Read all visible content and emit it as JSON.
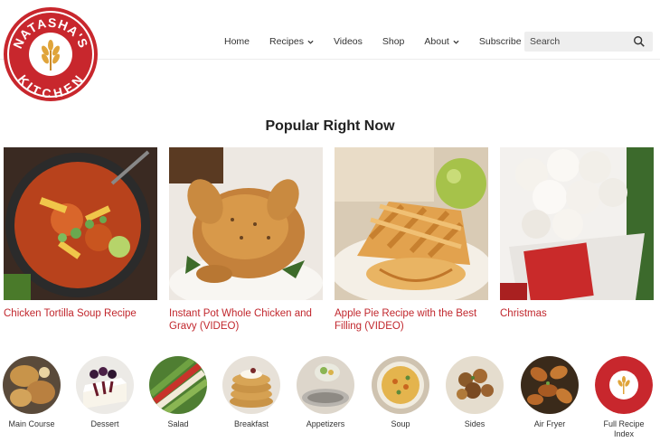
{
  "brand": {
    "logo_text_top": "NATASHA'S",
    "logo_text_bottom": "KITCHEN",
    "color": "#c8272d"
  },
  "nav": {
    "items": [
      {
        "label": "Home",
        "dropdown": false
      },
      {
        "label": "Recipes",
        "dropdown": true
      },
      {
        "label": "Videos",
        "dropdown": false
      },
      {
        "label": "Shop",
        "dropdown": false
      },
      {
        "label": "About",
        "dropdown": true
      },
      {
        "label": "Subscribe",
        "dropdown": false
      }
    ]
  },
  "search": {
    "placeholder": "Search",
    "icon": "search-icon"
  },
  "popular": {
    "title": "Popular Right Now",
    "cards": [
      {
        "title": "Chicken Tortilla Soup Recipe",
        "image": "soup-image"
      },
      {
        "title": "Instant Pot Whole Chicken and Gravy (VIDEO)",
        "image": "roast-chicken-image"
      },
      {
        "title": "Apple Pie Recipe with the Best Filling (VIDEO)",
        "image": "apple-pie-image"
      },
      {
        "title": "Christmas",
        "image": "snowball-cookies-image"
      }
    ]
  },
  "categories": [
    {
      "label": "Main Course"
    },
    {
      "label": "Dessert"
    },
    {
      "label": "Salad"
    },
    {
      "label": "Breakfast"
    },
    {
      "label": "Appetizers"
    },
    {
      "label": "Soup"
    },
    {
      "label": "Sides"
    },
    {
      "label": "Air Fryer"
    },
    {
      "label": "Full Recipe Index"
    }
  ],
  "colors": {
    "link": "#c1272d",
    "text": "#222222",
    "search_bg": "#eeeeee"
  }
}
